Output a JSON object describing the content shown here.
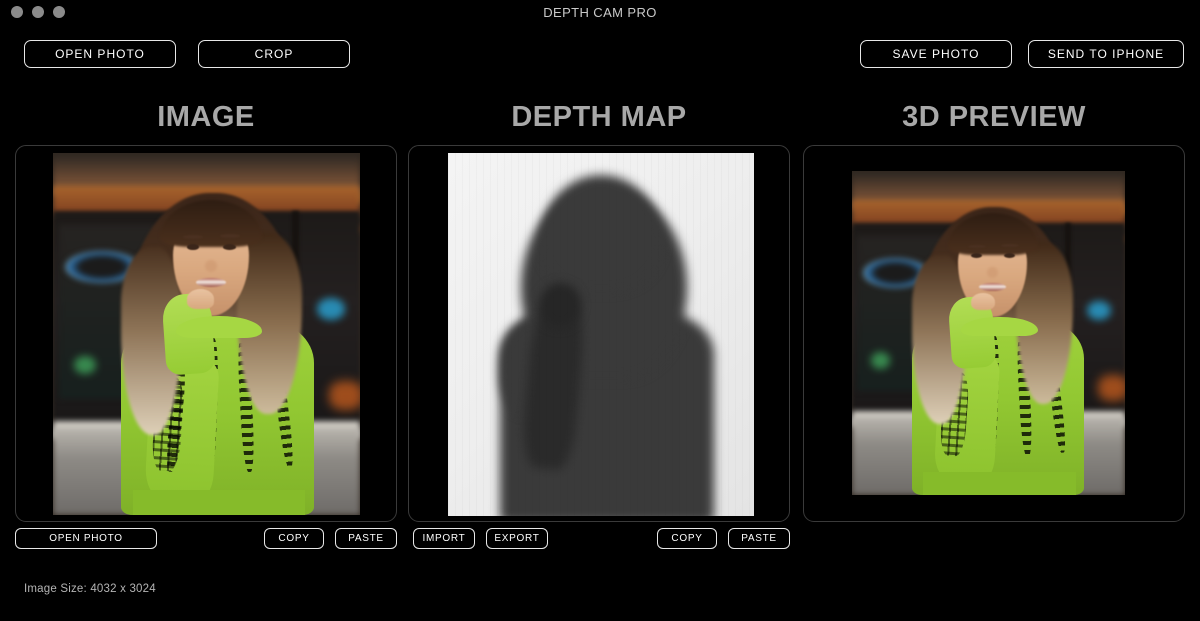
{
  "window": {
    "title": "DEPTH CAM PRO",
    "traffic_lights": [
      "close",
      "minimize",
      "zoom"
    ]
  },
  "toolbar": {
    "left": [
      {
        "label": "OPEN PHOTO",
        "name": "open-photo-button"
      },
      {
        "label": "CROP",
        "name": "crop-button"
      }
    ],
    "right": [
      {
        "label": "SAVE PHOTO",
        "name": "save-photo-button"
      },
      {
        "label": "SEND TO IPHONE",
        "name": "send-to-iphone-button"
      }
    ]
  },
  "columns": {
    "image": {
      "heading": "IMAGE",
      "buttons_left": [
        {
          "label": "OPEN PHOTO"
        }
      ],
      "buttons_right": [
        {
          "label": "COPY"
        },
        {
          "label": "PASTE"
        }
      ],
      "content": "portrait photo of a smiling woman in a lime-green knit sweater, blurred city storefront background"
    },
    "depth": {
      "heading": "DEPTH MAP",
      "buttons_left": [
        {
          "label": "IMPORT"
        },
        {
          "label": "EXPORT"
        }
      ],
      "buttons_right": [
        {
          "label": "COPY"
        },
        {
          "label": "PASTE"
        }
      ],
      "content": "grayscale depth map: dark subject silhouette on light background"
    },
    "preview": {
      "heading": "3D PREVIEW",
      "buttons_left": [],
      "buttons_right": [],
      "content": "3D rendered preview of the same portrait photo"
    }
  },
  "status": {
    "image_size_label": "Image Size: 4032 x 3024"
  },
  "colors": {
    "background": "#000000",
    "button_border": "#e8e8e8",
    "heading_text": "#a8a8a8",
    "panel_border": "#3a3a3a",
    "status_text": "#b4b4b4",
    "traffic_light": "#8b8b8b",
    "sweater_green": "#9fd13c"
  }
}
